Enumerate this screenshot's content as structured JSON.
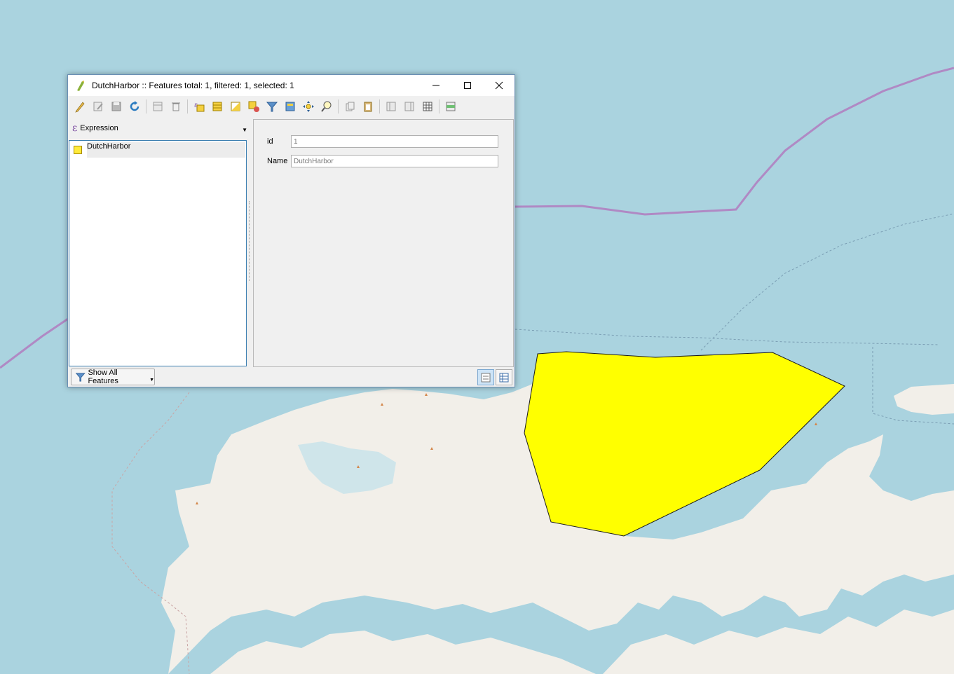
{
  "window": {
    "title": "DutchHarbor :: Features total: 1, filtered: 1, selected: 1"
  },
  "toolbar": {
    "icons": [
      "pencil-icon",
      "multi-edit-icon",
      "save-icon",
      "refresh-icon",
      "add-feature-icon",
      "delete-icon",
      "select-expression-icon",
      "select-all-icon",
      "invert-selection-icon",
      "deselect-icon",
      "filter-icon",
      "move-selected-top-icon",
      "pan-to-selected-icon",
      "zoom-to-selected-icon",
      "copy-icon",
      "paste-icon",
      "new-field-icon",
      "delete-field-icon",
      "field-calculator-icon",
      "conditional-formatting-icon"
    ]
  },
  "expression": {
    "label": "Expression"
  },
  "features": [
    {
      "label": "DutchHarbor"
    }
  ],
  "form": {
    "fields": [
      {
        "label": "id",
        "value": "1"
      },
      {
        "label": "Name",
        "value": "DutchHarbor"
      }
    ]
  },
  "footer": {
    "show_all_label": "Show All Features"
  },
  "colors": {
    "sea": "#aad3df",
    "land": "#f2efe9",
    "selection": "#ffff00",
    "border_line": "#b089c4"
  }
}
